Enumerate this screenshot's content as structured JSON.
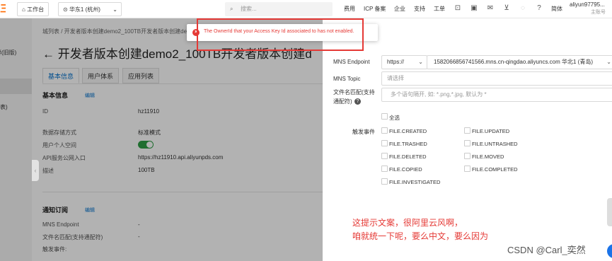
{
  "topbar": {
    "workbench": "工作台",
    "region": "华东1 (杭州)",
    "search_placeholder": "搜索...",
    "links": [
      "费用",
      "ICP 备案",
      "企业",
      "支持",
      "工单"
    ],
    "lang": "简体",
    "account": "aliyun97795...",
    "account_sub": "主账号"
  },
  "sidebar": {
    "item1": "群(旧版)",
    "item2": "表)"
  },
  "page": {
    "breadcrumb": "城列表  /  开发者版本创建demo2_100TB开发者版本创建demo2...",
    "title": "← 开发者版本创建demo2_100TB开发者版本创建d",
    "tabs": [
      "基本信息",
      "用户体系",
      "应用列表"
    ]
  },
  "basic_info": {
    "section": "基本信息",
    "edit": "编辑",
    "rows": [
      {
        "label": "ID",
        "value": "hz11910"
      },
      {
        "label": "数据存储方式",
        "value": "标准模式"
      },
      {
        "label": "用户个人空间",
        "value": ""
      },
      {
        "label": "API服务公网入口",
        "value": "https://hz11910.api.aliyunpds.com"
      },
      {
        "label": "描述",
        "value": "100TB"
      }
    ]
  },
  "notify": {
    "section": "通知订阅",
    "edit": "编辑",
    "rows": [
      {
        "label": "MNS Endpoint",
        "value": "-"
      },
      {
        "label": "文件名匹配(支持通配符)",
        "value": "-"
      },
      {
        "label": "触发事件:",
        "value": ""
      }
    ]
  },
  "drawer": {
    "endpoint_label": "MNS Endpoint",
    "protocol": "https://",
    "endpoint_value": "1582066856741566.mns.cn-qingdao.aliyuncs.com 华北1 (青岛)",
    "topic_label": "MNS Topic",
    "topic_placeholder": "请选择",
    "pattern_label_1": "文件名匹配(支持",
    "pattern_label_2": "通配符)",
    "pattern_placeholder": "多个语句隔开, 如: *.png,*.jpg, 默认为 *",
    "select_all": "全选",
    "events_label": "触发事件",
    "events_left": [
      "FILE.CREATED",
      "FILE.TRASHED",
      "FILE.DELETED",
      "FILE.COPIED",
      "FILE.INVESTIGATED"
    ],
    "events_right": [
      "FILE.UPDATED",
      "FILE.UNTRASHED",
      "FILE.MOVED",
      "FILE.COMPLETED"
    ]
  },
  "annotation": {
    "line1": "这提示文案，很阿里云风啊，",
    "line2": "咱就统一下呢，要么中文，要么因为"
  },
  "toast": {
    "message": "The OwnerId that your Access Key Id associated to has not enabled."
  },
  "watermark": "CSDN @Carl_奕然",
  "colors": {
    "accent": "#ff6a00",
    "link": "#0070cc",
    "error": "#e53935",
    "toggle": "#2e9e45"
  }
}
